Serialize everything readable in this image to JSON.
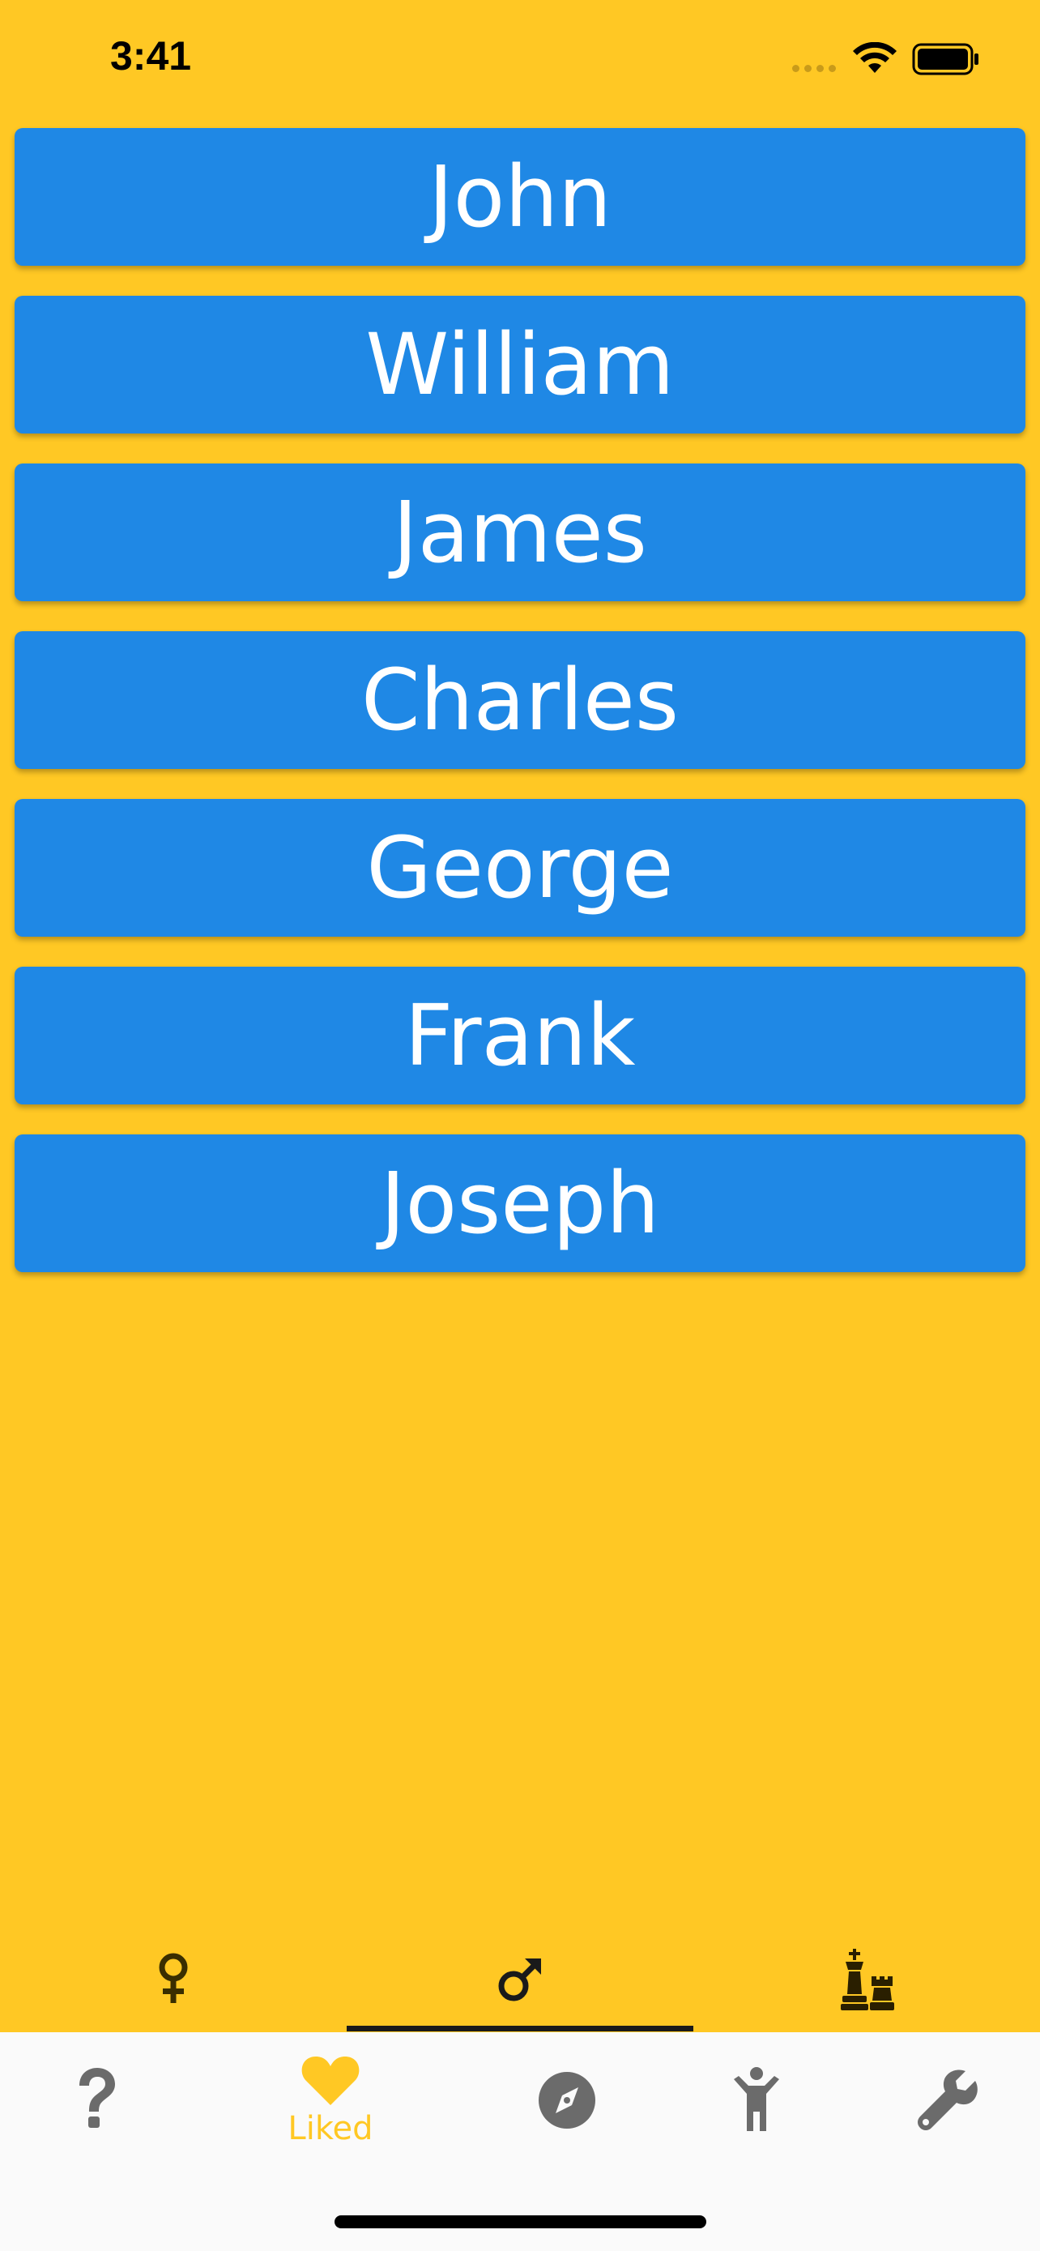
{
  "status_bar": {
    "time": "3:41"
  },
  "names": [
    {
      "label": "John"
    },
    {
      "label": "William"
    },
    {
      "label": "James"
    },
    {
      "label": "Charles"
    },
    {
      "label": "George"
    },
    {
      "label": "Frank"
    },
    {
      "label": "Joseph"
    }
  ],
  "gender_tabs": {
    "selected": "male",
    "items": [
      {
        "icon": "female-symbol-icon"
      },
      {
        "icon": "male-symbol-icon"
      },
      {
        "icon": "chess-pieces-icon"
      }
    ]
  },
  "bottom_nav": {
    "active": "liked",
    "items": [
      {
        "icon": "question-icon",
        "label": ""
      },
      {
        "icon": "heart-icon",
        "label": "Liked"
      },
      {
        "icon": "compass-icon",
        "label": ""
      },
      {
        "icon": "child-icon",
        "label": ""
      },
      {
        "icon": "wrench-icon",
        "label": ""
      }
    ]
  },
  "colors": {
    "background": "#ffc824",
    "button": "#1f88e5",
    "button_text": "#ffffff",
    "nav_inactive": "#6b6b6b",
    "nav_active": "#ffc824",
    "nav_background": "#fafafa"
  }
}
